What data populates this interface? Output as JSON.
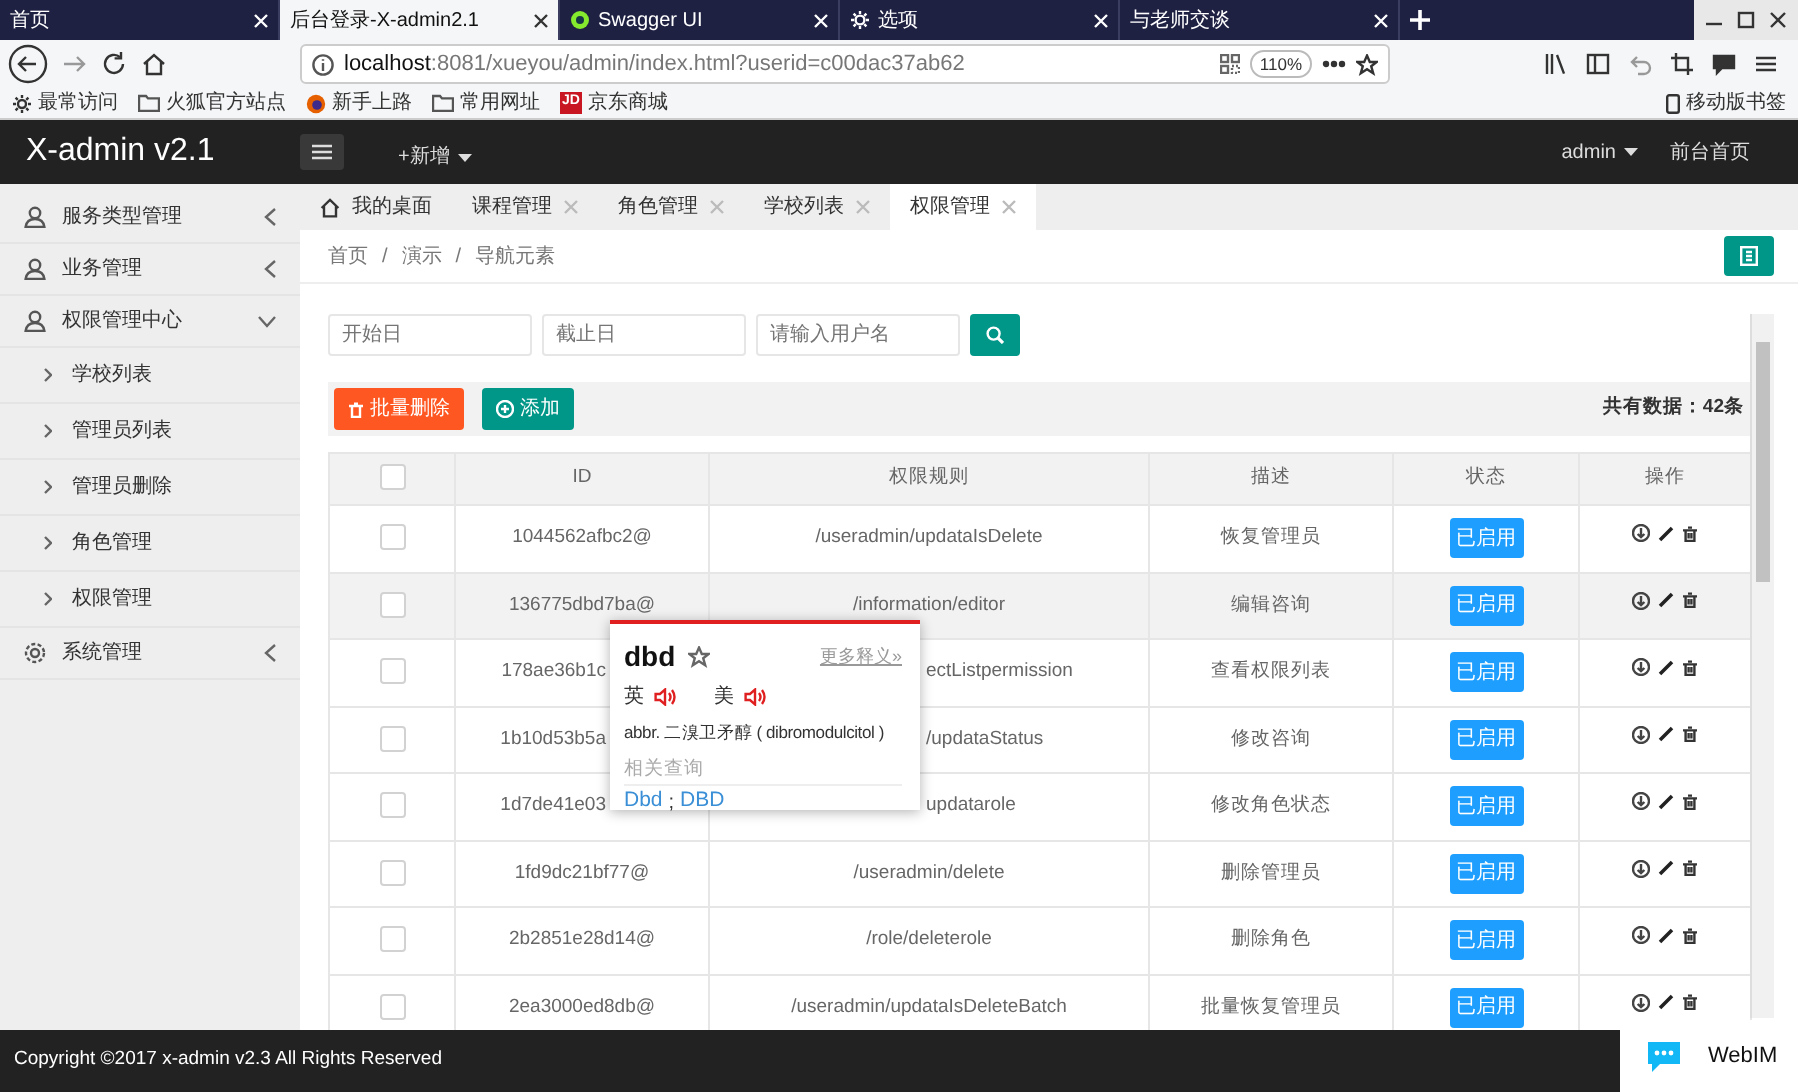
{
  "browser": {
    "tabs": [
      {
        "title": "首页",
        "selected": false,
        "kind": "plain"
      },
      {
        "title": "后台登录-X-admin2.1",
        "selected": true,
        "kind": "plain"
      },
      {
        "title": "Swagger UI",
        "selected": false,
        "kind": "swagger"
      },
      {
        "title": "选项",
        "selected": false,
        "kind": "settings"
      },
      {
        "title": "与老师交谈",
        "selected": false,
        "kind": "plain"
      }
    ],
    "url_host": "localhost",
    "url_rest": ":8081/xueyou/admin/index.html?userid=c00dac37ab62",
    "zoom": "110%",
    "bookmarks": [
      {
        "label": "最常访问",
        "kind": "gear"
      },
      {
        "label": "火狐官方站点",
        "kind": "folder"
      },
      {
        "label": "新手上路",
        "kind": "firefox"
      },
      {
        "label": "常用网址",
        "kind": "folder"
      },
      {
        "label": "京东商城",
        "kind": "jd",
        "badge": "JD"
      }
    ],
    "mobile_bookmarks": "移动版书签"
  },
  "header": {
    "brand": "X-admin v2.1",
    "add_menu": "+新增",
    "user": "admin",
    "home_link": "前台首页"
  },
  "sidebar": {
    "items": [
      {
        "label": "服务类型管理",
        "kind": "user",
        "expanded": false
      },
      {
        "label": "业务管理",
        "kind": "user",
        "expanded": false
      },
      {
        "label": "权限管理中心",
        "kind": "user",
        "expanded": true,
        "children": [
          {
            "label": "学校列表"
          },
          {
            "label": "管理员列表"
          },
          {
            "label": "管理员删除"
          },
          {
            "label": "角色管理"
          },
          {
            "label": "权限管理"
          }
        ]
      },
      {
        "label": "系统管理",
        "kind": "settings",
        "expanded": false
      }
    ]
  },
  "page_tabs": [
    {
      "label": "我的桌面",
      "kind": "home",
      "selected": false
    },
    {
      "label": "课程管理",
      "kind": "page",
      "selected": false
    },
    {
      "label": "角色管理",
      "kind": "page",
      "selected": false
    },
    {
      "label": "学校列表",
      "kind": "page",
      "selected": false
    },
    {
      "label": "权限管理",
      "kind": "page",
      "selected": true
    }
  ],
  "breadcrumb": [
    "首页",
    "演示",
    "导航元素"
  ],
  "breadcrumb_separator": "/",
  "filters": {
    "start_placeholder": "开始日",
    "end_placeholder": "截止日",
    "user_placeholder": "请输入用户名"
  },
  "toolbar": {
    "delete_label": "批量删除",
    "add_label": "添加",
    "total": "共有数据：42条"
  },
  "table": {
    "header_checked": false,
    "columns": [
      "ID",
      "权限规则",
      "描述",
      "状态",
      "操作"
    ],
    "rows": [
      {
        "checked": false,
        "highlighted": false,
        "id": "1044562afbc2@",
        "rule": "/useradmin/updataIsDelete",
        "desc": "恢复管理员",
        "status": "已启用"
      },
      {
        "checked": false,
        "highlighted": true,
        "id": "136775dbd7ba@",
        "rule": "/information/editor",
        "desc": "编辑咨询",
        "status": "已启用"
      },
      {
        "checked": false,
        "highlighted": false,
        "partly_hidden": true,
        "id": "178ae36b1c",
        "rule": "ectListpermission",
        "desc": "查看权限列表",
        "status": "已启用"
      },
      {
        "checked": false,
        "highlighted": false,
        "partly_hidden": true,
        "id": "1b10d53b5a",
        "rule": "/updataStatus",
        "desc": "修改咨询",
        "status": "已启用"
      },
      {
        "checked": false,
        "highlighted": false,
        "partly_hidden": true,
        "id": "1d7de41e03",
        "rule": "updatarole",
        "desc": "修改角色状态",
        "status": "已启用"
      },
      {
        "checked": false,
        "highlighted": false,
        "id": "1fd9dc21bf77@",
        "rule": "/useradmin/delete",
        "desc": "删除管理员",
        "status": "已启用"
      },
      {
        "checked": false,
        "highlighted": false,
        "id": "2b2851e28d14@",
        "rule": "/role/deleterole",
        "desc": "删除角色",
        "status": "已启用"
      },
      {
        "checked": false,
        "highlighted": false,
        "id": "2ea3000ed8db@",
        "rule": "/useradmin/updataIsDeleteBatch",
        "desc": "批量恢复管理员",
        "status": "已启用"
      }
    ]
  },
  "dictionary_popup": {
    "word": "dbd",
    "more": "更多释义»",
    "pronunciations": [
      "英",
      "美"
    ],
    "definition": "abbr. 二溴卫矛醇 ( dibromodulcitol )",
    "related_title": "相关查询",
    "related": [
      "Dbd",
      "DBD"
    ],
    "related_separator": ";"
  },
  "footer": {
    "copyright": "Copyright ©2017 x-admin v2.3 All Rights Reserved",
    "chat_label": "WebIM"
  }
}
